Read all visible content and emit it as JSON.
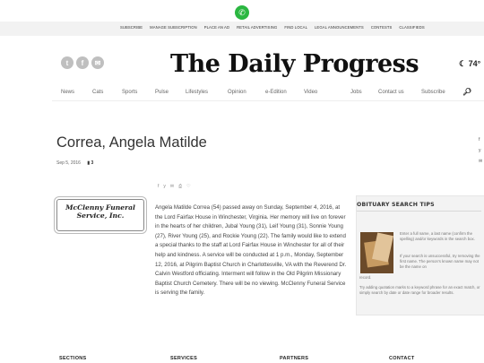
{
  "topbar": {
    "links": [
      "SUBSCRIBE",
      "MANAGE SUBSCRIPTION",
      "PLACE AN AD",
      "RETAIL ADVERTISING",
      "FIND LOCAL",
      "LEGAL ANNOUNCEMENTS",
      "CONTESTS",
      "CLASSIFIEDS"
    ]
  },
  "header": {
    "masthead": "The Daily Progress",
    "weather": "74°"
  },
  "nav": {
    "items": [
      "News",
      "Cats",
      "Sports",
      "Pulse",
      "Lifestyles",
      "Opinion",
      "e-Edition",
      "Video",
      "Jobs",
      "Contact us",
      "Subscribe"
    ]
  },
  "article": {
    "title": "Correa, Angela Matilde",
    "date": "Sep 5, 2016",
    "count": "3",
    "logo_line1": "McClenny Funeral",
    "logo_line2": "Service, Inc.",
    "body": "Angela Matilde Correa (54) passed away on Sunday, September 4, 2016, at the Lord Fairfax House in Winchester, Virginia. Her memory will live on forever in the hearts of her children, Jubal Young (31), Leif Young (31), Sonnie Young (27), River Young (25), and Rockie Young (22). The family would like to extend a special thanks to the staff at Lord Fairfax House in Winchester for all of their help and kindness. A service will be conducted at 1 p.m., Monday, September 12, 2016, at Pilgrim Baptist Church in Charlottesville, VA with the Reverend Dr. Calvin Westford officiating. Interment will follow in the Old Pilgrim Missionary Baptist Church Cemetery. There will be no viewing. McClenny Funeral Service is serving the family."
  },
  "tips": {
    "heading": "OBITUARY SEARCH TIPS",
    "p1": "Enter a full name, a last name (confirm the spelling) and/or keywords in the search box.",
    "p2a": "If your search is unsuccessful, try removing the first name. The person's known name may not be the name on",
    "p2b": "record.",
    "p3": "Try adding quotation marks to a keyword phrase for an exact match, or simply search by date or date range for broader results."
  },
  "footer": {
    "sections": "SECTIONS",
    "services": "SERVICES",
    "partners": "PARTNERS",
    "contact": "CONTACT"
  },
  "icons": {
    "whatsapp": "whatsapp-icon",
    "social": [
      "twitter-icon",
      "facebook-icon",
      "email-icon"
    ],
    "share": [
      "facebook-icon",
      "twitter-icon",
      "email-icon",
      "print-icon",
      "heart-icon"
    ],
    "search": "search-icon",
    "weather": "moon-icon",
    "comment": "comment-icon"
  },
  "colors": {
    "whatsapp": "#2bb741",
    "topbar_bg": "#f2f2f2",
    "tips_bg": "#f3f3f3"
  }
}
